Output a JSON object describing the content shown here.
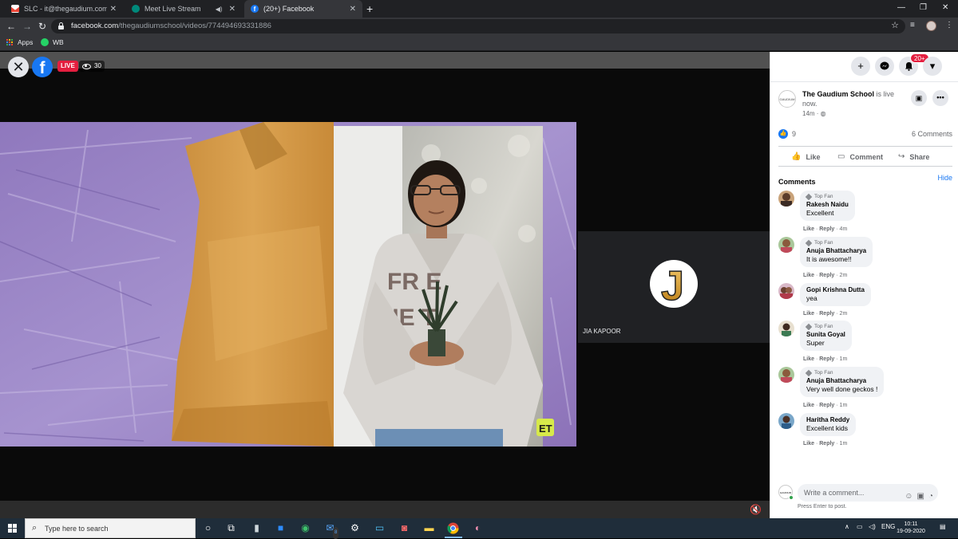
{
  "browser": {
    "tabs": [
      {
        "label": "SLC - it@thegaudium.com - Gau",
        "active": false
      },
      {
        "label": "Meet Live Stream",
        "active": false
      },
      {
        "label": "(20+) Facebook",
        "active": true
      }
    ],
    "url_domain": "facebook.com",
    "url_path": "/thegaudiumschool/videos/774494693331886",
    "bookmarks": [
      {
        "label": "Apps"
      },
      {
        "label": "WB"
      }
    ]
  },
  "video": {
    "live_label": "LIVE",
    "viewer_count": "30",
    "participant_initial": "J",
    "participant_name": "JIA KAPOOR",
    "shirt_text_line1": "FR  E",
    "shirt_text_line2": "HE  T",
    "corner_badge": "ET"
  },
  "sidebar": {
    "notif_badge": "20+",
    "page_name": "The Gaudium School",
    "is_live_text": " is live",
    "live_now_text": "now.",
    "post_time": "14m · ",
    "avatar_text": "GAUDIUM",
    "like_count": "9",
    "comment_count": "6 Comments",
    "actions": {
      "like": "Like",
      "comment": "Comment",
      "share": "Share"
    },
    "comments_title": "Comments",
    "hide_label": "Hide",
    "comments": [
      {
        "top_fan": true,
        "badge": "Top Fan",
        "author": "Rakesh Naidu",
        "text": "Excellent",
        "like": "Like",
        "reply": "Reply",
        "time": "4m"
      },
      {
        "top_fan": true,
        "badge": "Top Fan",
        "author": "Anuja Bhattacharya",
        "text": "It is awesome!!",
        "like": "Like",
        "reply": "Reply",
        "time": "2m"
      },
      {
        "top_fan": false,
        "badge": "",
        "author": "Gopi Krishna Dutta",
        "text": "yea",
        "like": "Like",
        "reply": "Reply",
        "time": "2m"
      },
      {
        "top_fan": true,
        "badge": "Top Fan",
        "author": "Sunita Goyal",
        "text": "Super",
        "like": "Like",
        "reply": "Reply",
        "time": "1m"
      },
      {
        "top_fan": true,
        "badge": "Top Fan",
        "author": "Anuja Bhattacharya",
        "text": "Very well done geckos !",
        "like": "Like",
        "reply": "Reply",
        "time": "1m"
      },
      {
        "top_fan": false,
        "badge": "",
        "author": "Haritha Reddy",
        "text": "Excellent kids",
        "like": "Like",
        "reply": "Reply",
        "time": "1m"
      }
    ],
    "write_placeholder": "Write a comment...",
    "press_enter": "Press Enter to post."
  },
  "taskbar": {
    "search_placeholder": "Type here to search",
    "mail_badge": "8",
    "language": "ENG",
    "time": "10:11",
    "date": "19-09-2020"
  },
  "colors": {
    "facebook_blue": "#1877f2",
    "live_red": "#e41e3f",
    "chrome_dark": "#202124",
    "taskbar": "#1f2d3a"
  }
}
